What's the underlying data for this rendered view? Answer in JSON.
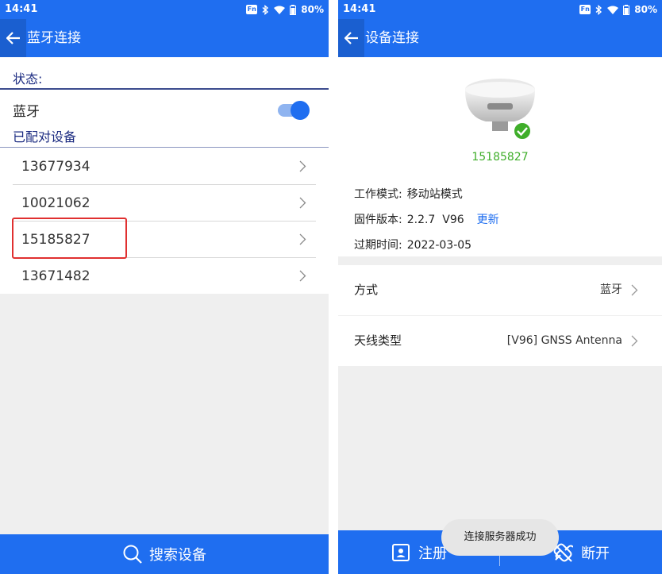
{
  "left": {
    "status": {
      "time": "14:41",
      "fn": "Fn",
      "battery": "80%"
    },
    "title": "蓝牙连接",
    "state_label": "状态:",
    "bluetooth_label": "蓝牙",
    "bluetooth_enabled": true,
    "paired_label": "已配对设备",
    "devices": [
      "13677934",
      "10021062",
      "15185827",
      "13671482"
    ],
    "search_label": "搜索设备"
  },
  "right": {
    "status": {
      "time": "14:41",
      "fn": "Fn",
      "battery": "80%"
    },
    "title": "设备连接",
    "serial": "15185827",
    "work_mode_label": "工作模式:",
    "work_mode_value": "移动站模式",
    "firmware_label": "固件版本:",
    "firmware_value": "2.2.7  V96",
    "update_label": "更新",
    "expiry_label": "过期时间:",
    "expiry_value": "2022-03-05",
    "method_label": "方式",
    "method_value": "蓝牙",
    "antenna_label": "天线类型",
    "antenna_value": "[V96] GNSS Antenna",
    "register_label": "注册",
    "disconnect_label": "断开",
    "toast": "连接服务器成功"
  },
  "colors": {
    "primary": "#1f6ef0",
    "success": "#3fae2a",
    "highlight": "#e03030"
  },
  "icons": [
    "back-arrow-icon",
    "bluetooth-icon",
    "wifi-icon",
    "battery-icon",
    "chevron-right-icon",
    "search-icon",
    "register-icon",
    "unlink-icon",
    "check-badge-icon"
  ]
}
